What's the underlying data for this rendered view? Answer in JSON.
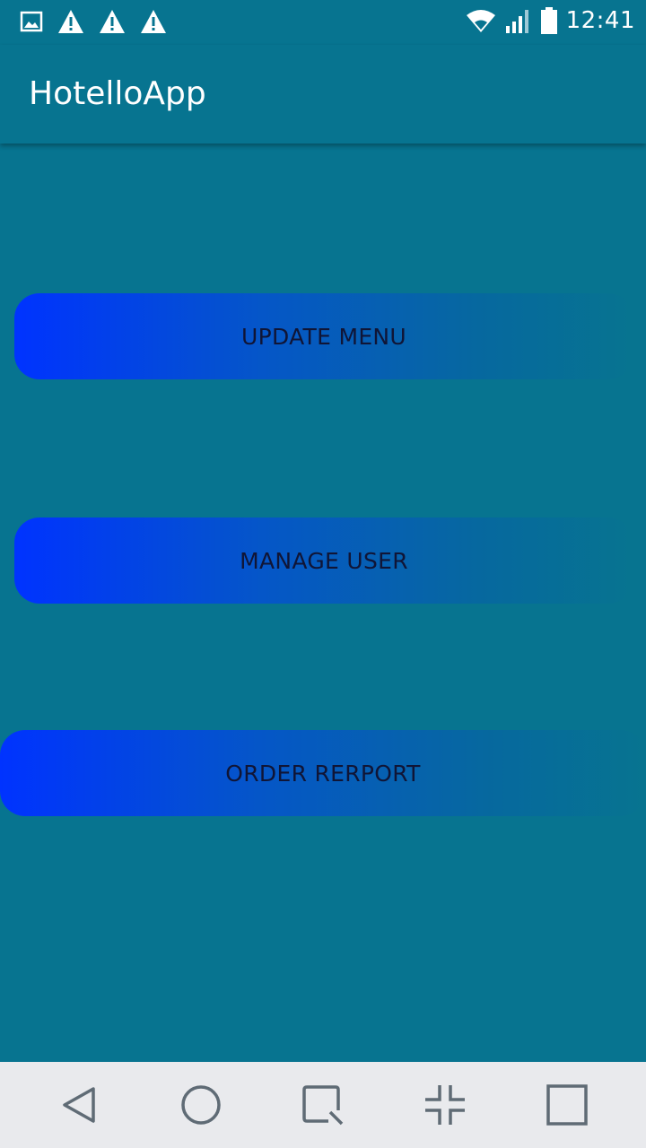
{
  "status_bar": {
    "time": "12:41",
    "icons": [
      "gallery-icon",
      "warning-icon",
      "warning-icon",
      "warning-icon",
      "wifi-icon",
      "signal-icon",
      "battery-icon"
    ]
  },
  "app_bar": {
    "title": "HotelloApp"
  },
  "buttons": [
    {
      "label": "UPDATE MENU"
    },
    {
      "label": "MANAGE USER"
    },
    {
      "label": "ORDER RERPORT"
    }
  ],
  "nav_bar": {
    "icons": [
      "back-icon",
      "home-icon",
      "recents-icon",
      "collapse-icon",
      "square-icon"
    ]
  },
  "colors": {
    "background": "#077490",
    "button_start": "#0033ff",
    "button_end": "#077490",
    "nav_bg": "#e9eaed"
  }
}
